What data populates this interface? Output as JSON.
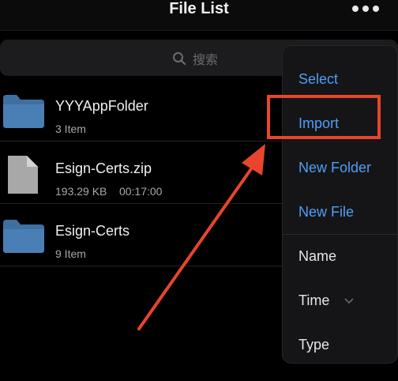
{
  "header": {
    "title": "File List",
    "more_icon": "ellipsis-icon"
  },
  "search": {
    "placeholder": "搜索",
    "icon": "search-icon"
  },
  "files": [
    {
      "name": "YYYAppFolder",
      "subtitle": "3 Item",
      "icon": "folder-icon"
    },
    {
      "name": "Esign-Certs.zip",
      "subtitle": "193.29 KB    00:17:00",
      "icon": "document-icon"
    },
    {
      "name": "Esign-Certs",
      "subtitle": "9 Item",
      "icon": "folder-icon"
    }
  ],
  "menu": {
    "actions": [
      "Select",
      "Import",
      "New Folder",
      "New File"
    ],
    "sort_options": [
      "Name",
      "Time",
      "Type"
    ],
    "sort_chevron_icon": "chevron-down-icon"
  },
  "colors": {
    "background": "#000000",
    "accent": "#4f9ef8",
    "folder": "#3e6fa1",
    "annotation": "#e8452c"
  }
}
